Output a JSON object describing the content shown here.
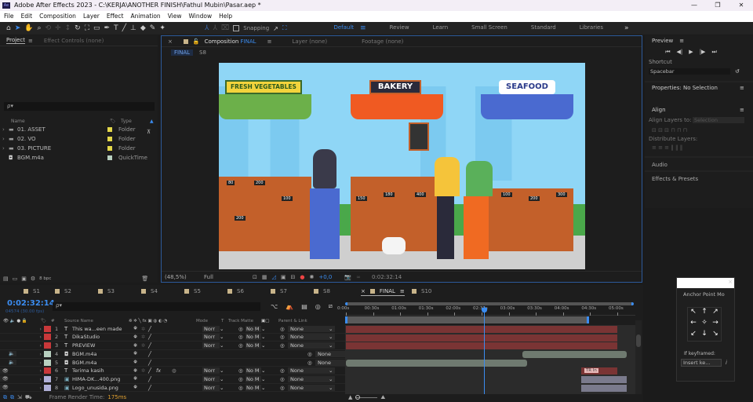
{
  "window": {
    "title": "Adobe After Effects 2023 - C:\\KERJA\\ANOTHER FINISH\\Fathul Mubin\\Pasar.aep *",
    "logo": "Ae",
    "controls": [
      "—",
      "❐",
      "✕"
    ]
  },
  "menu": [
    "File",
    "Edit",
    "Composition",
    "Layer",
    "Effect",
    "Animation",
    "View",
    "Window",
    "Help"
  ],
  "toolbar": {
    "snapping_label": "Snapping",
    "workspaces": [
      "Default",
      "Review",
      "Learn",
      "Small Screen",
      "Standard",
      "Libraries"
    ],
    "active_workspace": "Default",
    "more": "»"
  },
  "project": {
    "tabs": [
      "Project",
      "Effect Controls (none)"
    ],
    "search_placeholder": "ρ▾",
    "columns": [
      "Name",
      "Type"
    ],
    "items": [
      {
        "name": "01. ASSET",
        "type": "Folder",
        "color": "#e4d84a",
        "kind": "folder"
      },
      {
        "name": "02. VO",
        "type": "Folder",
        "color": "#e4d84a",
        "kind": "folder"
      },
      {
        "name": "03. PICTURE",
        "type": "Folder",
        "color": "#e4d84a",
        "kind": "folder"
      },
      {
        "name": "BGM.m4a",
        "type": "QuickTime",
        "color": "#b8d0c0",
        "kind": "audio"
      }
    ],
    "bpc": "8 bpc"
  },
  "composition": {
    "tabs": [
      "Composition",
      "Layer (none)",
      "Footage (none)"
    ],
    "comp_name": "FINAL",
    "breadcrumbs": [
      "FINAL",
      "S8"
    ],
    "zoom": "(48,5%)",
    "resolution": "Full",
    "exposure": "+0,0",
    "timecode": "0:02:32:14",
    "scene": {
      "signs": [
        "FRESH VEGETABLES",
        "BAKERY",
        "SEAFOOD"
      ],
      "prices": [
        "80",
        "200",
        "100",
        "200",
        "150",
        "180",
        "400",
        "100",
        "200",
        "300"
      ]
    }
  },
  "right": {
    "preview_title": "Preview",
    "shortcut_label": "Shortcut",
    "shortcut_value": "Spacebar",
    "properties": "Properties: No Selection",
    "align_title": "Align",
    "align_to_label": "Align Layers to:",
    "align_to_value": "Selection",
    "distribute_label": "Distribute Layers:",
    "audio": "Audio",
    "effects": "Effects & Presets"
  },
  "anchor": {
    "title": "Anchor Point Mo",
    "if_keyframed": "If keyframed:",
    "insert": "Insert ke...",
    "info": "i"
  },
  "timeline": {
    "comp_tabs": [
      "S1",
      "S2",
      "S3",
      "S4",
      "S5",
      "S6",
      "S7",
      "S8",
      "FINAL",
      "S10"
    ],
    "active_tab": "FINAL",
    "timecode": "0:02:32:14",
    "frames": "04574 (30.00 fps)",
    "headers": {
      "num": "#",
      "source": "Source Name",
      "mode": "Mode",
      "t": "T",
      "track_matte": "Track Matte",
      "parent": "Parent & Link"
    },
    "ruler": [
      "0:00s",
      "00:30s",
      "01:00s",
      "01:30s",
      "02:00s",
      "02:30s",
      "03:00s",
      "03:30s",
      "04:00s",
      "04:30s",
      "05:00s"
    ],
    "playhead_seconds": 152.5,
    "duration_seconds": 300,
    "layers": [
      {
        "num": "1",
        "name": "This wa...een made",
        "type": "text",
        "label": "#c8383a",
        "mode": "Norr",
        "matte": "No M",
        "parent": "None",
        "start": 0,
        "end": 300,
        "bar": "#7a3434",
        "eye": false,
        "audio": false
      },
      {
        "num": "2",
        "name": "DikaStudio",
        "type": "text",
        "label": "#c8383a",
        "mode": "Norr",
        "matte": "No M",
        "parent": "None",
        "start": 0,
        "end": 300,
        "bar": "#7a3434",
        "eye": false,
        "audio": false
      },
      {
        "num": "3",
        "name": "PREVIEW",
        "type": "text",
        "label": "#c8383a",
        "mode": "Norr",
        "matte": "No M",
        "parent": "None",
        "start": 0,
        "end": 300,
        "bar": "#7a3434",
        "eye": false,
        "audio": false
      },
      {
        "num": "4",
        "name": "BGM.m4a",
        "type": "audio",
        "label": "#b8d0c0",
        "mode": "",
        "matte": "",
        "parent": "None",
        "start": 195,
        "end": 310,
        "bar": "#6f7a70",
        "eye": false,
        "audio": true
      },
      {
        "num": "5",
        "name": "BGM.m4a",
        "type": "audio",
        "label": "#b8d0c0",
        "mode": "",
        "matte": "",
        "parent": "None",
        "start": 0,
        "end": 200,
        "bar": "#6f7a70",
        "eye": false,
        "audio": true
      },
      {
        "num": "6",
        "name": "Terima kasih",
        "type": "text",
        "label": "#c8383a",
        "mode": "Norr",
        "matte": "No M",
        "parent": "None",
        "start": 260,
        "end": 300,
        "bar": "#7a3434",
        "eye": true,
        "audio": false,
        "marker": "TR In"
      },
      {
        "num": "7",
        "name": "HIMA-DK...400.png",
        "type": "image",
        "label": "#b0b0d8",
        "mode": "Norr",
        "matte": "No M",
        "parent": "None",
        "start": 260,
        "end": 310,
        "bar": "#7a7a8c",
        "eye": true,
        "audio": false
      },
      {
        "num": "8",
        "name": "Logo_unusida.png",
        "type": "image",
        "label": "#b0b0d8",
        "mode": "Norr",
        "matte": "No M",
        "parent": "None",
        "start": 260,
        "end": 310,
        "bar": "#7a7a8c",
        "eye": true,
        "audio": false
      }
    ],
    "render_label": "Frame Render Time:",
    "render_value": "175ms"
  }
}
